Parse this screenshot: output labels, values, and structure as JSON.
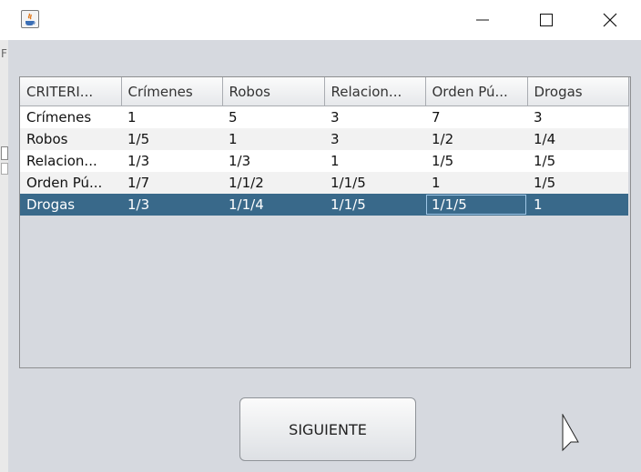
{
  "window": {
    "icon": "java-icon",
    "controls": [
      "minimize-icon",
      "maximize-icon",
      "close-icon"
    ]
  },
  "background_window": {
    "visible_letter": "F"
  },
  "table": {
    "columns": [
      "CRITERI...",
      "Crímenes",
      "Robos",
      "Relacion...",
      "Orden Pú...",
      "Drogas"
    ],
    "rows": [
      [
        "Crímenes",
        "1",
        "5",
        "3",
        "7",
        "3"
      ],
      [
        "Robos",
        "1/5",
        "1",
        "3",
        "1/2",
        "1/4"
      ],
      [
        "Relacion...",
        "1/3",
        "1/3",
        "1",
        "1/5",
        "1/5"
      ],
      [
        "Orden Pú...",
        "1/7",
        "1/1/2",
        "1/1/5",
        "1",
        "1/5"
      ],
      [
        "Drogas",
        "1/3",
        "1/1/4",
        "1/1/5",
        "1/1/5",
        "1"
      ]
    ],
    "selected_row": 4,
    "focused_cell_column": 4
  },
  "button": {
    "label": "SIGUIENTE"
  },
  "colors": {
    "selection": "#39698a",
    "panel": "#d6d9df"
  }
}
